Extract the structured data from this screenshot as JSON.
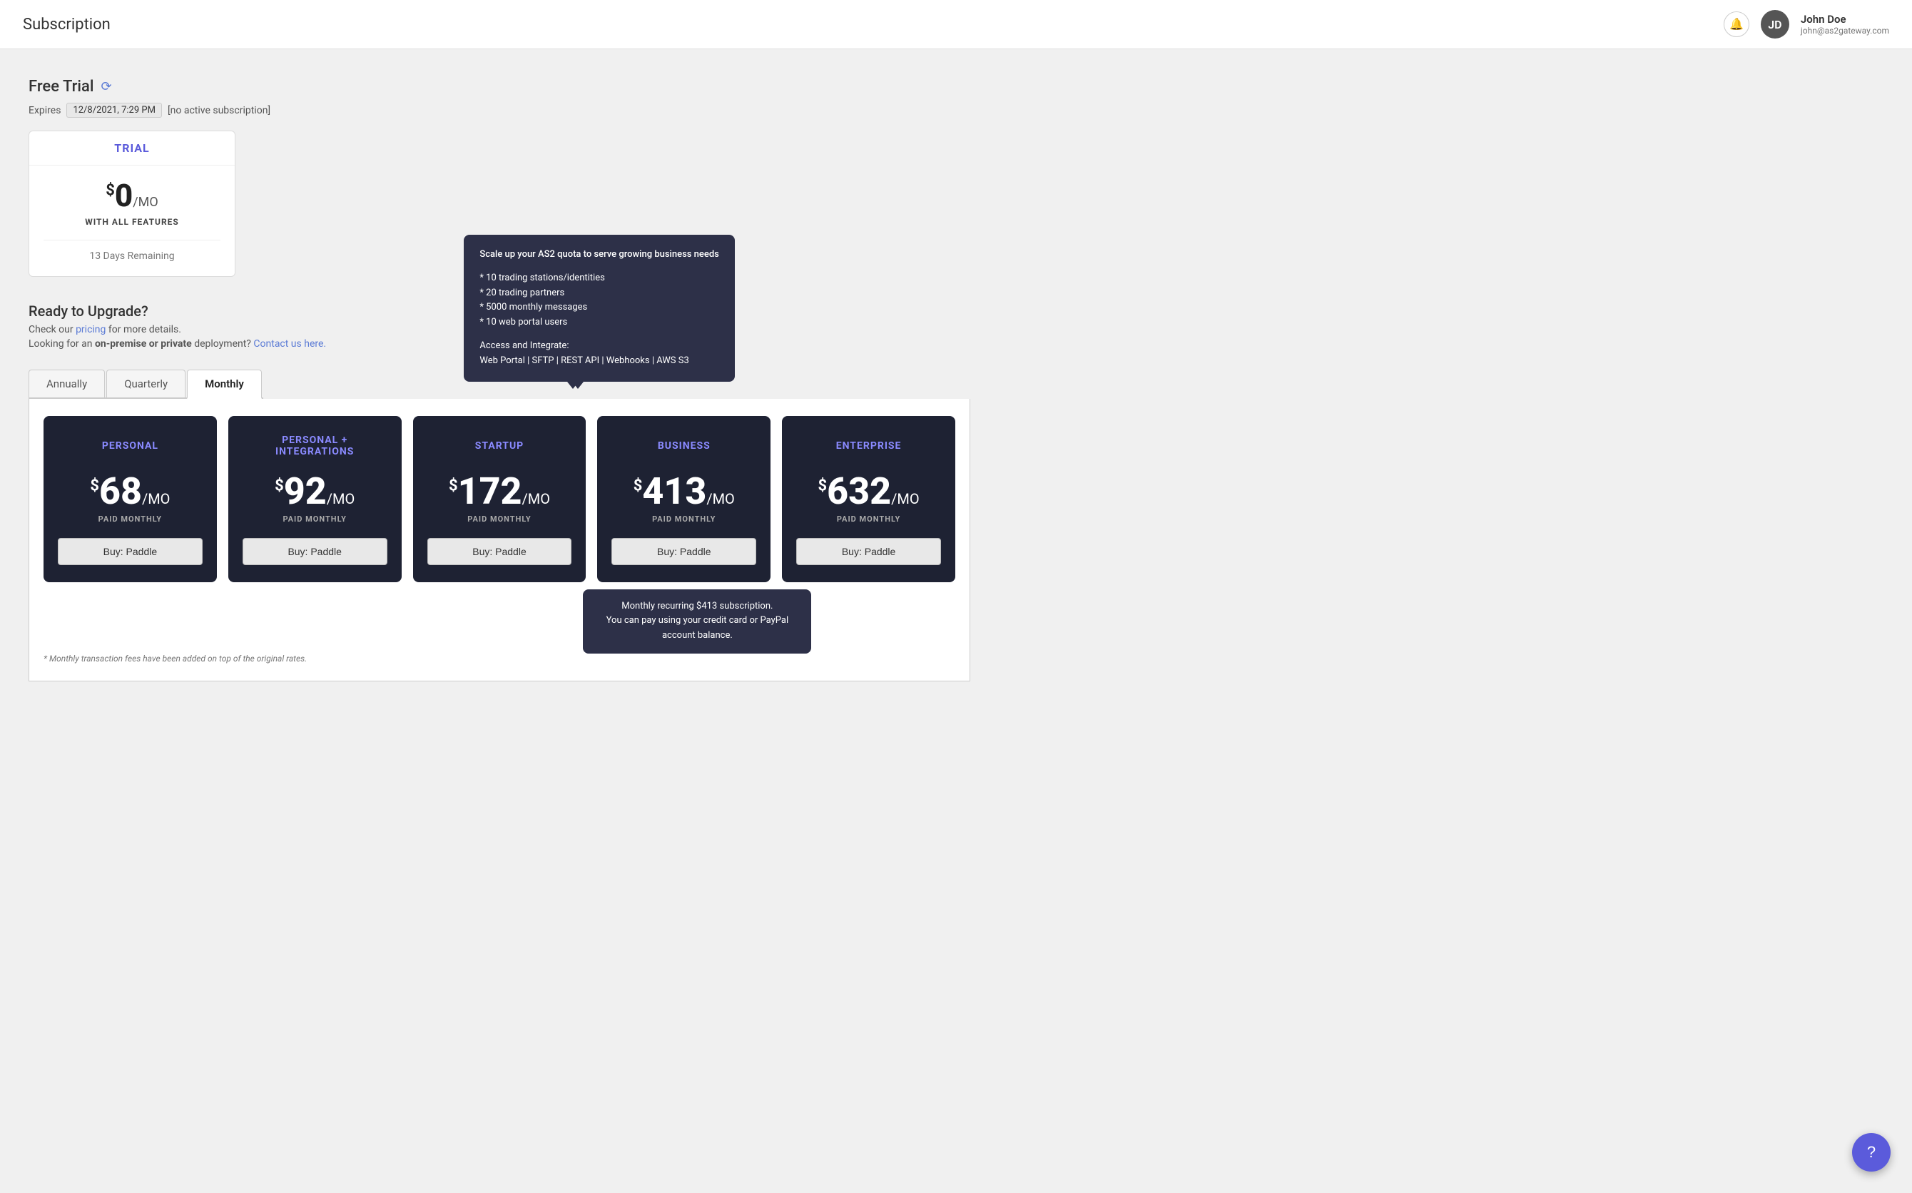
{
  "header": {
    "title": "Subscription",
    "bell_label": "🔔",
    "user": {
      "name": "John Doe",
      "email": "john@as2gateway.com",
      "initials": "JD"
    }
  },
  "trial_section": {
    "heading": "Free Trial",
    "expires_label": "Expires",
    "expires_date": "12/8/2021, 7:29 PM",
    "no_subscription": "[no active subscription]",
    "card": {
      "label": "TRIAL",
      "price_dollar": "$",
      "price_amount": "0",
      "price_period": "/MO",
      "features": "WITH ALL FEATURES",
      "remaining": "13 Days Remaining"
    }
  },
  "upgrade_section": {
    "heading": "Ready to Upgrade?",
    "line1_pre": "Check our ",
    "line1_link": "pricing",
    "line1_post": " for more details.",
    "line2_pre": "Looking for an ",
    "line2_bold": "on-premise or private",
    "line2_mid": " deployment? ",
    "line2_link": "Contact us here.",
    "line2_post": ""
  },
  "tabs": [
    {
      "label": "Annually",
      "active": false
    },
    {
      "label": "Quarterly",
      "active": false
    },
    {
      "label": "Monthly",
      "active": true
    }
  ],
  "tooltip": {
    "heading": "Scale up your AS2 quota to serve growing business needs",
    "features": [
      "* 10 trading stations/identities",
      "* 20 trading partners",
      "* 5000 monthly messages",
      "* 10 web portal users"
    ],
    "access_label": "Access and Integrate:",
    "access_detail": "Web Portal | SFTP | REST API | Webhooks | AWS S3"
  },
  "plans": [
    {
      "name": "PERSONAL",
      "price": "68",
      "period": "/MO",
      "billing": "PAID MONTHLY",
      "buy_label": "Buy: Paddle"
    },
    {
      "name": "PERSONAL +\nINTEGRATIONS",
      "price": "92",
      "period": "/MO",
      "billing": "PAID MONTHLY",
      "buy_label": "Buy: Paddle"
    },
    {
      "name": "STARTUP",
      "price": "172",
      "period": "/MO",
      "billing": "PAID MONTHLY",
      "buy_label": "Buy: Paddle"
    },
    {
      "name": "BUSINESS",
      "price": "413",
      "period": "/MO",
      "billing": "PAID MONTHLY",
      "buy_label": "Buy: Paddle",
      "has_tooltip": true
    },
    {
      "name": "ENTERPRISE",
      "price": "632",
      "period": "/MO",
      "billing": "PAID MONTHLY",
      "buy_label": "Buy: Paddle"
    }
  ],
  "bottom_tooltip": {
    "line1": "Monthly recurring $413 subscription.",
    "line2": "You can pay using your credit card or PayPal account balance."
  },
  "transaction_note": "* Monthly transaction fees have been added on top of the original rates.",
  "help_button": "?"
}
